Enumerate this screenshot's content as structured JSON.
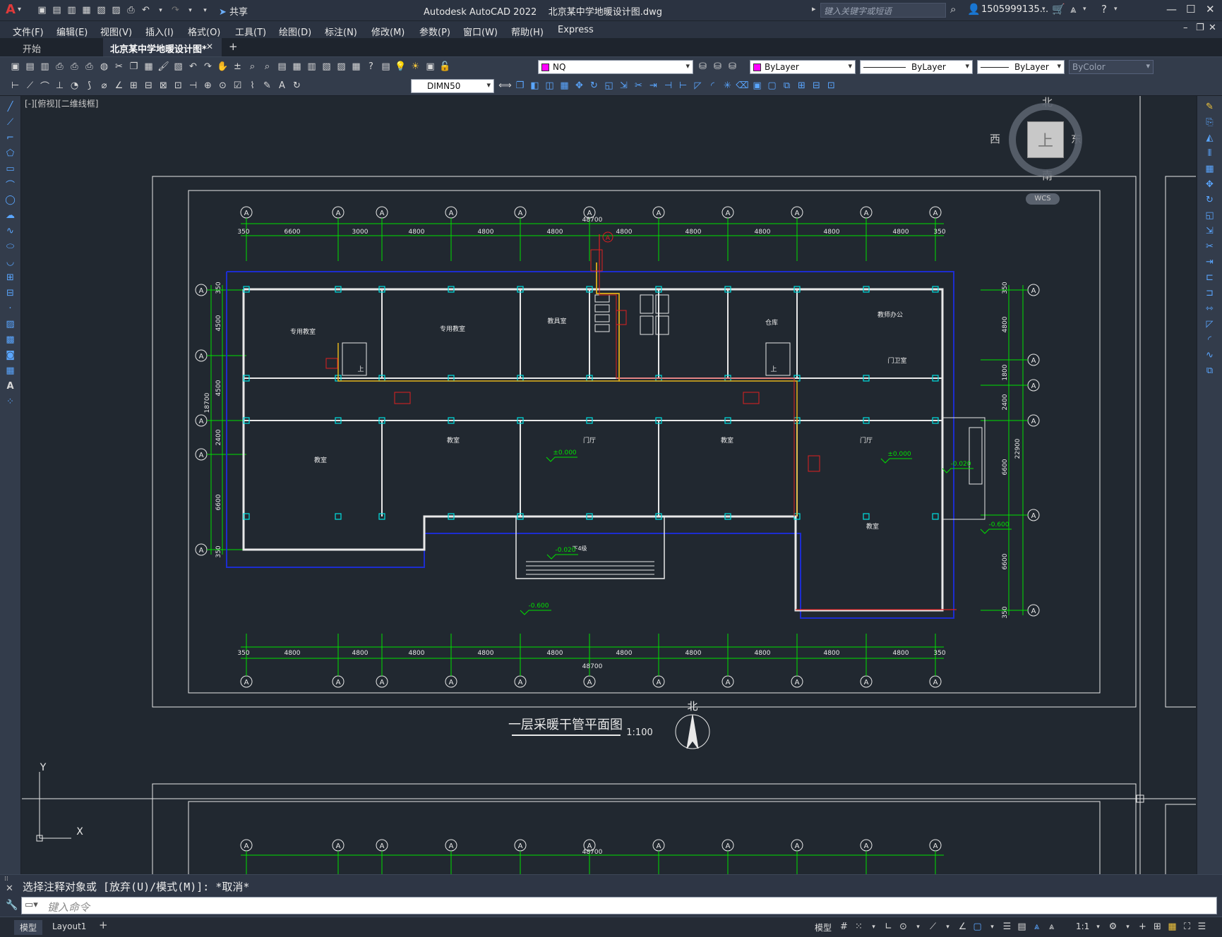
{
  "app": {
    "title": "Autodesk AutoCAD 2022",
    "filename": "北京某中学地暖设计图.dwg",
    "share_label": "共享",
    "search_placeholder": "键入关键字或短语",
    "user": "1505999135...",
    "logo": "A"
  },
  "menus": [
    "文件(F)",
    "编辑(E)",
    "视图(V)",
    "插入(I)",
    "格式(O)",
    "工具(T)",
    "绘图(D)",
    "标注(N)",
    "修改(M)",
    "参数(P)",
    "窗口(W)",
    "帮助(H)",
    "Express"
  ],
  "tabs": [
    {
      "label": "开始"
    },
    {
      "label": "北京某中学地暖设计图*"
    }
  ],
  "toolbar": {
    "layer": "NQ",
    "color": "ByLayer",
    "linetype": "ByLayer",
    "lineweight": "ByLayer",
    "plotstyle": "ByColor",
    "dimstyle": "DIMN50",
    "layer_color": "#ff00ff"
  },
  "viewport": {
    "label": "[-][俯视][二维线框]",
    "compass": {
      "n": "北",
      "s": "南",
      "e": "东",
      "w": "西",
      "top": "上",
      "wcs": "WCS"
    }
  },
  "drawing": {
    "title": "一层采暖干管平面图",
    "scale": "1:100",
    "north": "北",
    "total_width": "48700",
    "total_depth_left": "18700",
    "total_depth_right": "22900",
    "top_dims": [
      "350",
      "6600",
      "3000",
      "4800",
      "4800",
      "4800",
      "4800",
      "4800",
      "4800",
      "4800",
      "4800",
      "350"
    ],
    "bottom_dims": [
      "350",
      "4800",
      "4800",
      "4800",
      "4800",
      "4800",
      "4800",
      "4800",
      "4800",
      "4800",
      "4800",
      "350"
    ],
    "left_dims": [
      "350",
      "4500",
      "4500",
      "2400",
      "6600",
      "350"
    ],
    "right_dims": [
      "350",
      "4800",
      "1800",
      "2400",
      "6600",
      "6600",
      "350"
    ],
    "axis_label": "A",
    "rooms": [
      "专用教室",
      "专用教室",
      "教具室",
      "仓库",
      "教师办公",
      "门卫室",
      "教室",
      "门厅",
      "教室",
      "门厅",
      "教室",
      "教室"
    ],
    "levels": [
      "±0.000",
      "±0.000",
      "-0.020",
      "-0.020",
      "-0.600",
      "-0.600"
    ],
    "label_up": "上",
    "label_step": "下4级",
    "bottom_partial_dim": "48700"
  },
  "ucs": {
    "x": "X",
    "y": "Y"
  },
  "command": {
    "history": "选择注释对象或 [放弃(U)/模式(M)]: *取消*",
    "placeholder": "键入命令"
  },
  "status": {
    "tabs": [
      "模型",
      "Layout1"
    ],
    "model_label": "模型",
    "scale": "1:1"
  }
}
